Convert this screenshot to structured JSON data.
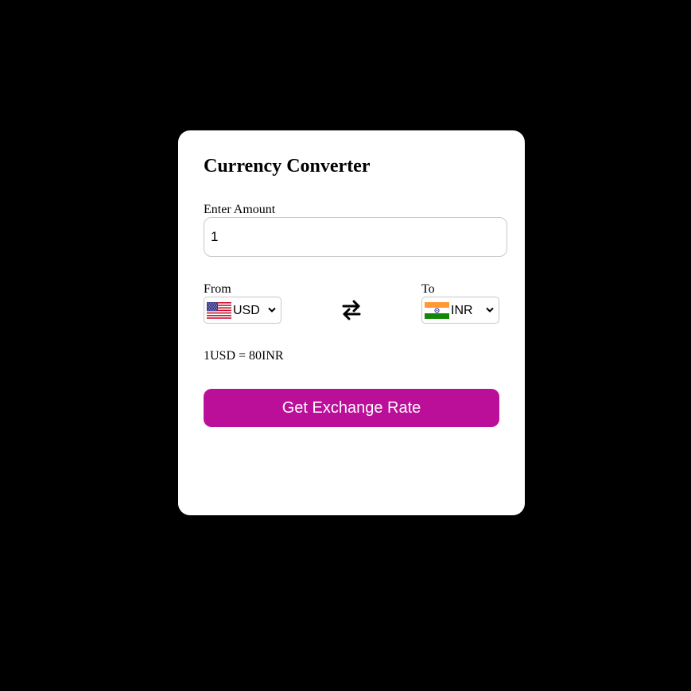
{
  "converter": {
    "title": "Currency Converter",
    "amount_label": "Enter Amount",
    "amount_value": "1",
    "from_label": "From",
    "to_label": "To",
    "from_currency": "USD",
    "to_currency": "INR",
    "from_flag": "us-flag-icon",
    "to_flag": "in-flag-icon",
    "swap_icon": "swap-arrows-icon",
    "rate_text": "1USD = 80INR",
    "button_label": "Get Exchange Rate"
  },
  "colors": {
    "background": "#000000",
    "card": "#ffffff",
    "button": "#bb0e99",
    "button_text": "#ffffff"
  }
}
